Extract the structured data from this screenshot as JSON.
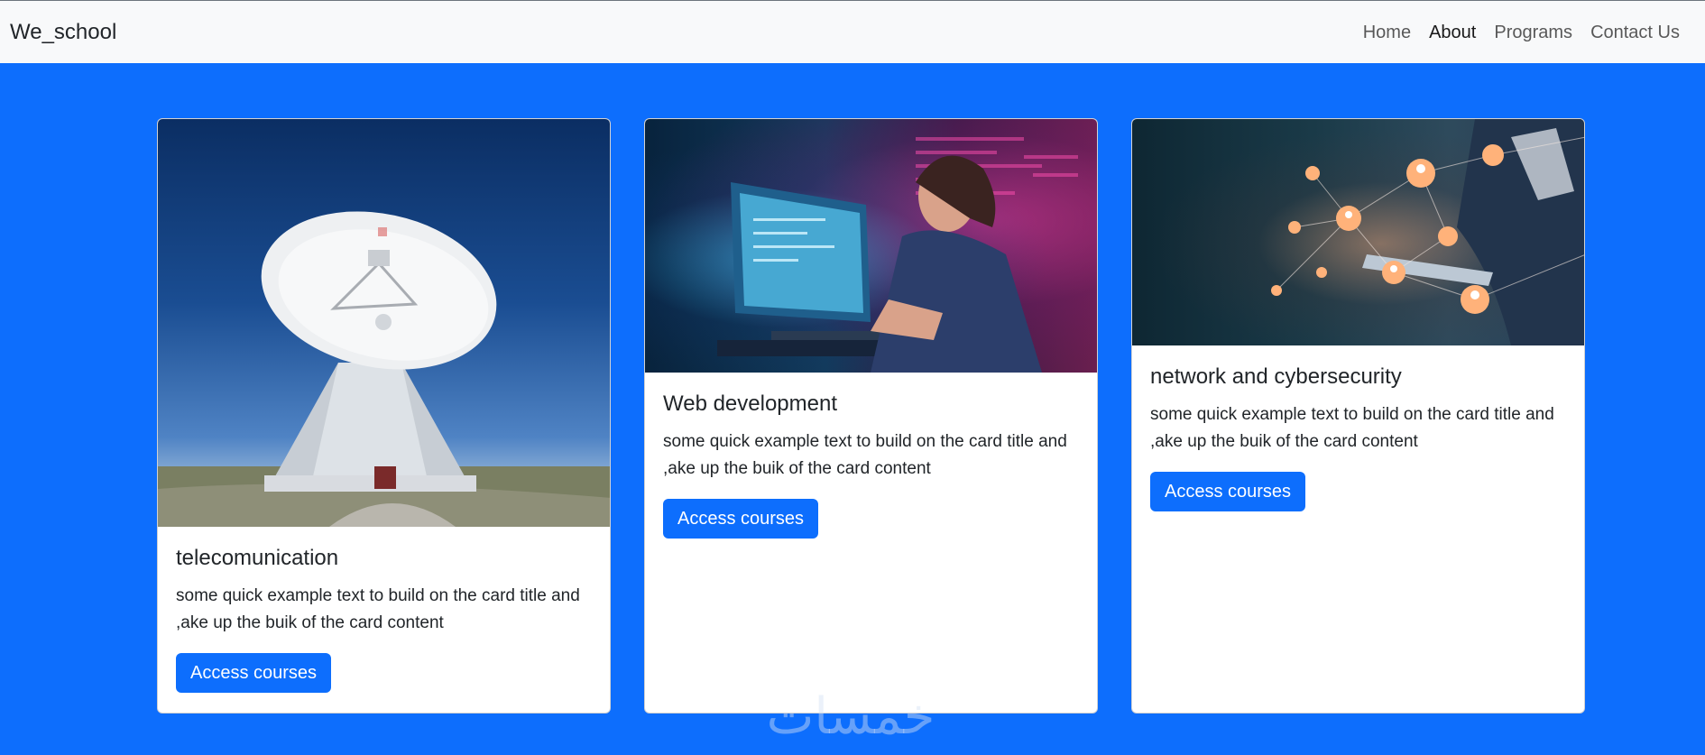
{
  "navbar": {
    "brand": "We_school",
    "links": [
      {
        "label": "Home"
      },
      {
        "label": "About"
      },
      {
        "label": "Programs"
      },
      {
        "label": "Contact Us"
      }
    ]
  },
  "cards": [
    {
      "title": "telecomunication",
      "text": "some quick example text to build on the card title and ,ake up the buik of the card content",
      "button": "Access courses",
      "image": "satellite-dish-image"
    },
    {
      "title": "Web development",
      "text": "some quick example text to build on the card title and ,ake up the buik of the card content",
      "button": "Access courses",
      "image": "coder-at-computer-image"
    },
    {
      "title": "network and cybersecurity",
      "text": "some quick example text to build on the card title and ,ake up the buik of the card content",
      "button": "Access courses",
      "image": "network-connections-image"
    }
  ],
  "watermark": "خمسات",
  "colors": {
    "background": "#0d6efd",
    "navbar": "#f8f9fa",
    "button": "#0d6efd"
  }
}
